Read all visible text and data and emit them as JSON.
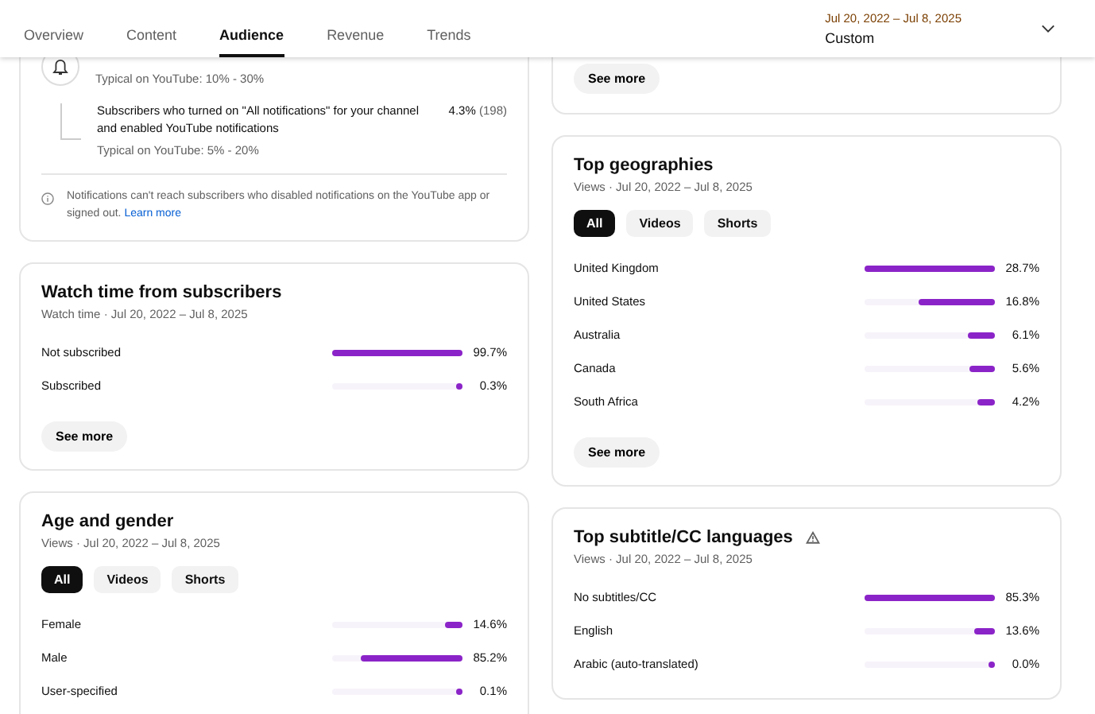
{
  "tabs": [
    {
      "label": "Overview",
      "selected": false
    },
    {
      "label": "Content",
      "selected": false
    },
    {
      "label": "Audience",
      "selected": true
    },
    {
      "label": "Revenue",
      "selected": false
    },
    {
      "label": "Trends",
      "selected": false
    }
  ],
  "date_range": {
    "range": "Jul 20, 2022 – Jul 8, 2025",
    "label": "Custom"
  },
  "notifications_card": {
    "rows": [
      {
        "kind": "main",
        "typical": "Typical on YouTube: 10% - 30%"
      },
      {
        "kind": "sub",
        "label": "Subscribers who turned on \"All notifications\" for your channel and enabled YouTube notifications",
        "value": "4.3%",
        "count": "(198)",
        "typical": "Typical on YouTube: 5% - 20%"
      }
    ],
    "note": "Notifications can't reach subscribers who disabled notifications on the YouTube app or signed out.",
    "link": "Learn more"
  },
  "left_cards": [
    {
      "title": "Watch time from subscribers",
      "subtitle": "Watch time · Jul 20, 2022 – Jul 8, 2025",
      "rows": [
        {
          "label": "Not subscribed",
          "value": "99.7%",
          "level": 1.0
        },
        {
          "label": "Subscribed",
          "value": "0.3%",
          "level": 0.02
        }
      ],
      "button": "See more"
    },
    {
      "title": "Age and gender",
      "subtitle": "Views · Jul 20, 2022 – Jul 8, 2025",
      "filters": [
        {
          "label": "All",
          "selected": true
        },
        {
          "label": "Videos",
          "selected": false
        },
        {
          "label": "Shorts",
          "selected": false
        }
      ],
      "rows": [
        {
          "label": "Female",
          "value": "14.6%",
          "level": 0.13
        },
        {
          "label": "Male",
          "value": "85.2%",
          "level": 0.78
        },
        {
          "label": "User-specified",
          "value": "0.1%",
          "level": 0.02
        }
      ]
    }
  ],
  "right_cards": [
    {
      "button": "See more"
    },
    {
      "title": "Top geographies",
      "subtitle": "Views · Jul 20, 2022 – Jul 8, 2025",
      "filters": [
        {
          "label": "All",
          "selected": true
        },
        {
          "label": "Videos",
          "selected": false
        },
        {
          "label": "Shorts",
          "selected": false
        }
      ],
      "rows": [
        {
          "label": "United Kingdom",
          "value": "28.7%",
          "level": 1.0
        },
        {
          "label": "United States",
          "value": "16.8%",
          "level": 0.58
        },
        {
          "label": "Australia",
          "value": "6.1%",
          "level": 0.21
        },
        {
          "label": "Canada",
          "value": "5.6%",
          "level": 0.19
        },
        {
          "label": "South Africa",
          "value": "4.2%",
          "level": 0.14
        }
      ],
      "button": "See more"
    },
    {
      "title": "Top subtitle/CC languages",
      "warning_icon": true,
      "subtitle": "Views · Jul 20, 2022 – Jul 8, 2025",
      "rows": [
        {
          "label": "No subtitles/CC",
          "value": "85.3%",
          "level": 1.0
        },
        {
          "label": "English",
          "value": "13.6%",
          "level": 0.16
        },
        {
          "label": "Arabic (auto-translated)",
          "value": "0.0%",
          "level": 0.02
        }
      ]
    }
  ]
}
